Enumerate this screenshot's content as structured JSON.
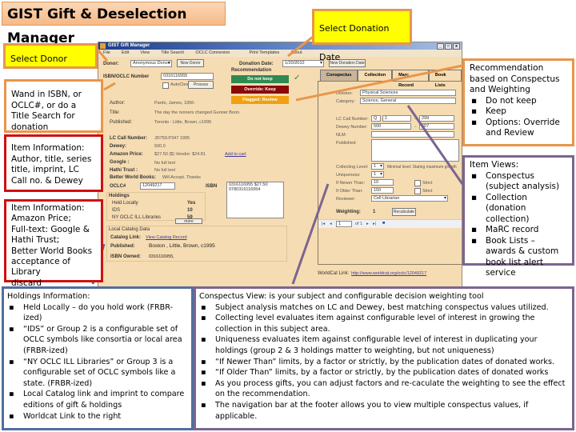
{
  "banner": {
    "title": "GIST Gift & Deselection Manager"
  },
  "callouts": {
    "select_donor": "Select Donor",
    "select_donation_date": "Select Donation Date",
    "wand_isbn": "Wand in ISBN, or OCLC#, or do a Title Search for donation",
    "item_info_1": "Item Information: Author, title, series title, imprint, LC Call no. & Dewey",
    "item_info_2_lines": [
      "Item Information:",
      "Amazon Price;",
      "Full-text: Google &",
      "Hathi Trust;",
      "Better World Books",
      "acceptance of Library",
      "discard"
    ],
    "recommendation": {
      "heading": "Recommendation based on Conspectus and Weighting",
      "items": [
        "Do not keep",
        "Keep",
        "Options: Override and Review"
      ]
    },
    "item_views": {
      "heading": "Item Views:",
      "items": [
        "Conspectus (subject analysis)",
        "Collection (donation collection)",
        "MaRC record",
        "Book Lists – awards & custom book list alert service"
      ]
    },
    "holdings_info": {
      "heading": "Holdings Information:",
      "items": [
        "Held Locally – do you hold work (FRBR-ized)",
        "“IDS” or Group 2 is a configurable set of OCLC symbols like consortia or local area (FRBR-ized)",
        "“NY OCLC ILL Libraries” or Group 3 is a configurable set of OCLC symbols like a state. (FRBR-ized)",
        "Local Catalog link and imprint to compare editions of gift & holdings",
        "Worldcat Link to the right"
      ]
    },
    "conspectus_view": {
      "heading": "Conspectus View: is your subject and configurable decision weighting tool",
      "items": [
        "Subject analysis matches on LC and Dewey, best matching conspectus values utilized.",
        "Collecting level evaluates item against configurable level of interest in growing the collection in this subject area.",
        "Uniqueness evaluates item against configurable level of interest in duplicating your holdings (group 2 & 3 holdings matter to weighting, but not uniqueness)",
        "“If Newer Than” limits, by a factor or strictly, by the publication dates of donated works.",
        "“If Older Than” limits, by a factor or strictly, by the publication dates of donated works",
        "As you process gifts, you can adjust factors and re-caculate the weighting to see the effect on the recommendation.",
        "The navigation bar at the footer allows you to view multiple conspectus values, if applicable."
      ]
    }
  },
  "app": {
    "window_title": "GIST Gift Manager",
    "window_buttons": [
      "_",
      "□",
      "x"
    ],
    "menu": [
      "File",
      "Edit",
      "View",
      "Title Search",
      "OCLC Connexion",
      "Print Templates",
      "About"
    ],
    "donor_label": "Donor:",
    "donor_value": "Anonymous Donor",
    "new_donor": "New Donor",
    "donation_date_label": "Donation Date:",
    "donation_date_value": "1/20/2010",
    "new_donation_date": "New Donation Date",
    "isbn_label": "ISBN/OCLC Number",
    "isbn_value": "0316116955",
    "autoclear": "AutoClear",
    "process": "Process",
    "recommendation_label": "Recommendation",
    "rec_buttons": {
      "do_not_keep": "Do not keep",
      "override_keep": "Override: Keep",
      "flag_review": "Flagged: Review"
    },
    "colors": {
      "do_not_keep": "#2e8a52",
      "override_keep": "#8a0a0a",
      "flag_review": "#f0a010"
    },
    "item": {
      "author_label": "Author:",
      "author": "Pardo, James, 1956-",
      "title_label": "Title:",
      "title": "The day the runners changed Gunner Bonn.",
      "published_label": "Published:",
      "published": "Toronto : Little, Brown, c1995",
      "lc_label": "LC Call Number:",
      "lc": "JD759.P347 1995",
      "dewey_label": "Dewey:",
      "dewey": "500.0",
      "amazon_label": "Amazon Price:",
      "amazon": "$27.50 ($) Vendor: $24.81",
      "amazon_link": "Add to cart",
      "google_label": "Google :",
      "google": "No full text",
      "hathi_label": "Hathi Trust :",
      "hathi": "No full text",
      "bwb_label": "Better World Books:",
      "bwb": "Will Accept. Thanks",
      "oclc_label": "OCLC#",
      "oclc": "12049217",
      "isbn_label": "ISBN",
      "isbn_list": [
        "0316116955 $27.50",
        "9780316116954"
      ]
    },
    "holdings": {
      "heading": "Holdings",
      "rows": [
        {
          "label": "Held Locally",
          "value": "Yes"
        },
        {
          "label": "IDS",
          "value": "10"
        },
        {
          "label": "NY OCLC ILL Libraries",
          "value": "59"
        }
      ],
      "more_button": "more"
    },
    "local_catalog": {
      "heading": "Local Catalog Data",
      "link_label": "Catalog Link:",
      "link": "View Catalog Record",
      "published_label": "Published:",
      "published": "Boston , Little, Brown, c1995",
      "isbn_owned_label": "ISBN Owned:",
      "isbn_owned": "0316116955,"
    },
    "tabs": [
      "Conspectus",
      "Collection",
      "Marc Record",
      "Book Lists"
    ],
    "conspectus": {
      "division_label": "Division:",
      "division": "Physical Sciences",
      "category_label": "Category:",
      "category": "Science, General",
      "lc_label": "LC Call Number:",
      "lc_from_a": "Q",
      "lc_from_b": "1",
      "lc_to": "299",
      "dewey_label": "Dewey Number:",
      "dewey_from": "500",
      "dewey_to": "507",
      "nlm_label": "NLM:",
      "published_label": "Published:",
      "collecting_label": "Collecting Level:",
      "collecting": "1",
      "collecting_note": "Minimal level: Stating maximum growth",
      "uniqueness_label": "Uniqueness:",
      "uniqueness": "1",
      "newer_label": "If Newer Than:",
      "newer": "10",
      "older_label": "If Older Than:",
      "older": "150",
      "strict_label": "Strict",
      "reviewer_label": "Reviewer:",
      "reviewer": "Cell Librarian",
      "weighting_label": "Weighting:",
      "weighting": "1",
      "recalculate": "Recalculate",
      "nav_page": "1",
      "nav_of": "of 1"
    },
    "worldcat_label": "WorldCat Link:",
    "worldcat_link": "http://www.worldcat.org/oclc/12049217"
  }
}
